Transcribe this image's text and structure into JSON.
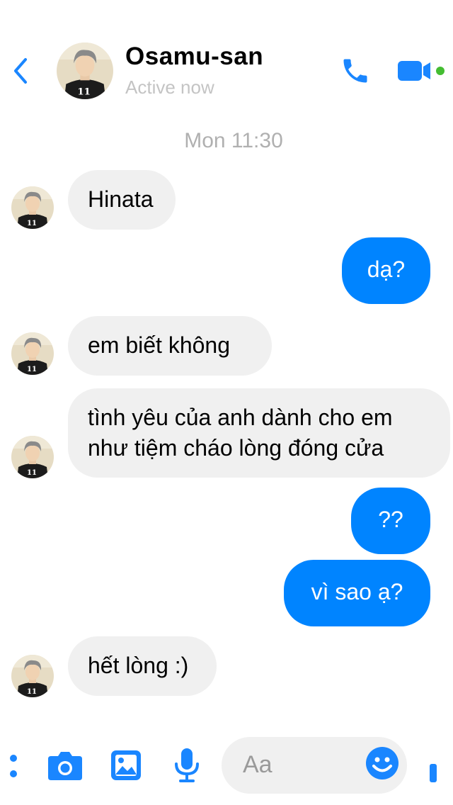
{
  "header": {
    "name": "Osamu-san",
    "status": "Active now"
  },
  "timestamp": "Mon 11:30",
  "avatar_number": "11",
  "messages": [
    {
      "side": "in",
      "text": "Hinata"
    },
    {
      "side": "out",
      "text": "dạ?"
    },
    {
      "side": "in",
      "text": "em biết không"
    },
    {
      "side": "in",
      "lines": [
        "tình yêu của anh dành cho em",
        "như tiệm cháo lòng đóng cửa"
      ]
    },
    {
      "side": "out",
      "text": "??"
    },
    {
      "side": "out",
      "text": "vì sao ạ?"
    },
    {
      "side": "in",
      "text": "hết lòng :)"
    }
  ],
  "composer": {
    "placeholder": "Aa"
  },
  "colors": {
    "accent": "#0084ff",
    "incoming_bubble": "#f0f0f0",
    "online": "#44bd32"
  },
  "icons": [
    "back-chevron-icon",
    "phone-icon",
    "video-camera-icon",
    "more-icon",
    "camera-icon",
    "gallery-icon",
    "microphone-icon",
    "emoji-icon",
    "like-icon"
  ]
}
